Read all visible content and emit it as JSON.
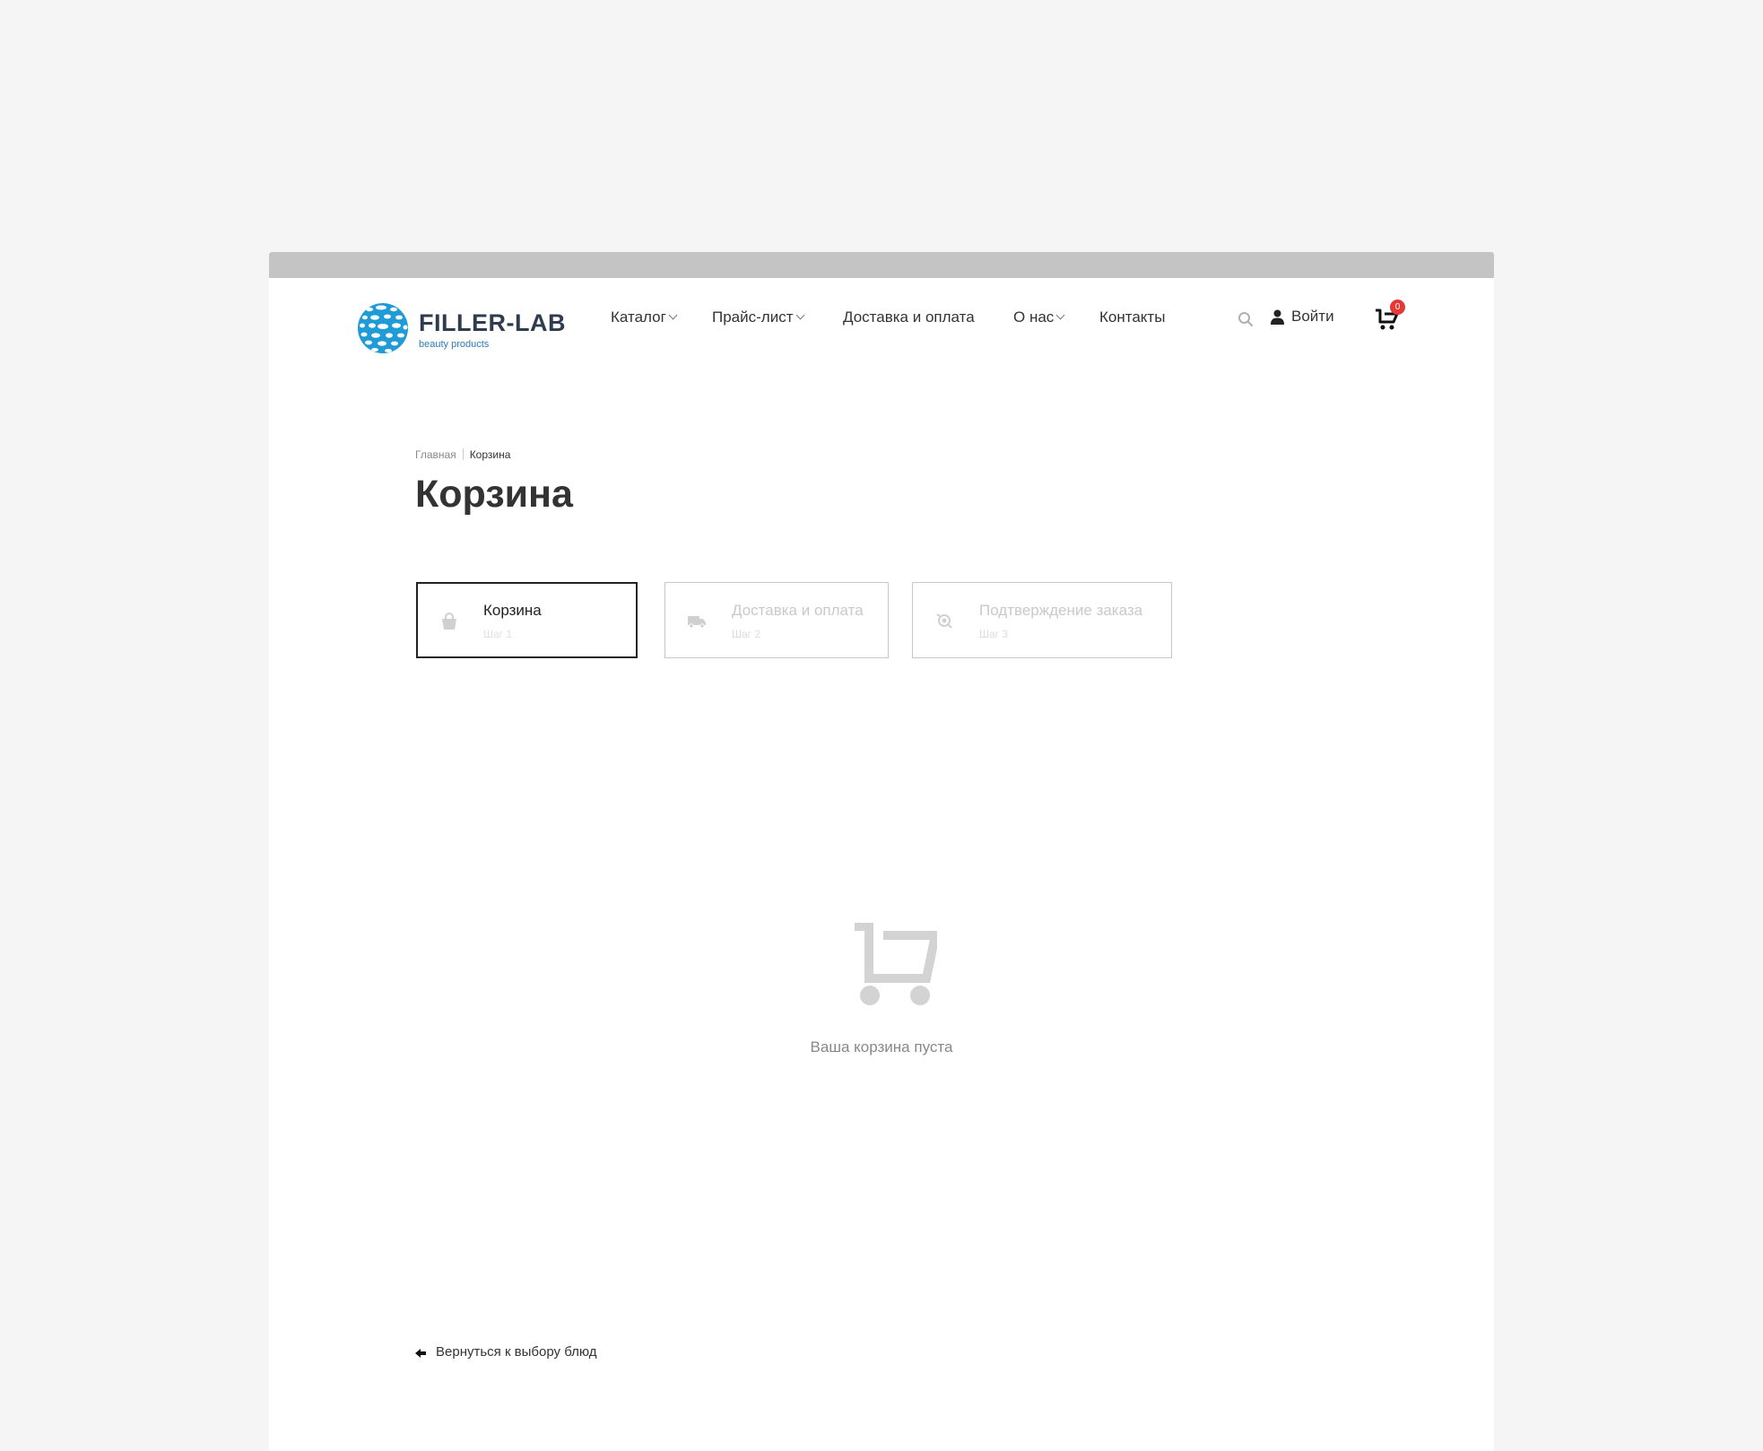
{
  "brand": {
    "name": "FILLER-LAB",
    "tagline": "beauty products",
    "colors": {
      "primary": "#1f9bd7",
      "dark": "#2f3c4f"
    }
  },
  "header": {
    "nav": [
      {
        "label": "Каталог",
        "has_dropdown": true
      },
      {
        "label": "Прайс-лист",
        "has_dropdown": true
      },
      {
        "label": "Доставка и оплата",
        "has_dropdown": false
      },
      {
        "label": "О нас",
        "has_dropdown": true
      },
      {
        "label": "Контакты",
        "has_dropdown": false
      }
    ],
    "search_icon": "search-icon",
    "login_label": "Войти",
    "cart_count": "0",
    "badge_color": "#e53935"
  },
  "breadcrumb": {
    "home": "Главная",
    "current": "Корзина"
  },
  "page": {
    "title": "Корзина"
  },
  "steps": [
    {
      "label": "Корзина",
      "sub": "Шаг 1",
      "icon": "shopping-bag-icon",
      "active": true
    },
    {
      "label": "Доставка и оплата",
      "sub": "Шаг 2",
      "icon": "truck-icon",
      "active": false
    },
    {
      "label": "Подтверждение заказа",
      "sub": "Шаг 3",
      "icon": "confirm-icon",
      "active": false
    }
  ],
  "empty_state": {
    "icon": "cart-icon",
    "text": "Ваша корзина пуста"
  },
  "back_link": {
    "label": "Вернуться к выбору блюд",
    "icon": "arrow-left-icon"
  }
}
